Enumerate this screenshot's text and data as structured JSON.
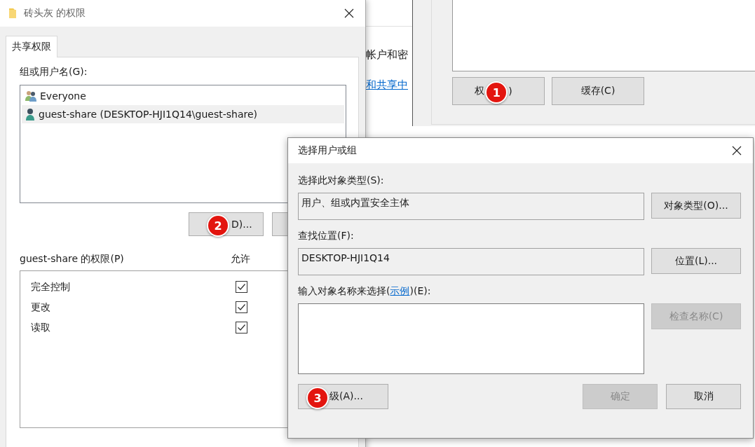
{
  "background_window": {
    "buttons": [
      {
        "label_before": "权",
        "label_after": ")",
        "badge": "1"
      },
      {
        "label": "缓存(C)"
      }
    ]
  },
  "middle_window": {
    "text": "帐户和密",
    "link": "和共享中"
  },
  "permissions_dialog": {
    "title": "砖头灰 的权限",
    "tabs": [
      {
        "label": "共享权限",
        "selected": true
      }
    ],
    "groups_label": "组或用户名(G):",
    "principals": [
      {
        "name": "Everyone",
        "kind": "group",
        "selected": false
      },
      {
        "name": "guest-share (DESKTOP-HJI1Q14\\guest-share)",
        "kind": "user",
        "selected": true
      }
    ],
    "buttons": [
      {
        "label_after": "D)...",
        "badge": "2"
      }
    ],
    "permissions_label": "guest-share 的权限(P)",
    "allow_header": "允许",
    "permissions": [
      {
        "name": "完全控制",
        "allow": true
      },
      {
        "name": "更改",
        "allow": true
      },
      {
        "name": "读取",
        "allow": true
      }
    ]
  },
  "select_dialog": {
    "title": "选择用户或组",
    "object_type_label": "选择此对象类型(S):",
    "object_type": "用户、组或内置安全主体",
    "object_type_button": {
      "label": "对象类型(O)...",
      "disabled": false
    },
    "location_label": "查找位置(F):",
    "location": "DESKTOP-HJI1Q14",
    "location_button": {
      "label": "位置(L)...",
      "disabled": false
    },
    "names_label": {
      "before": "输入对象名称来选择(",
      "link": "示例",
      "after": ")(E):"
    },
    "check_names_button": {
      "label": "检查名称(C)",
      "disabled": true
    },
    "advanced_button": {
      "label_after": "级(A)...",
      "disabled": false,
      "badge": "3"
    },
    "ok_button": {
      "label": "确定",
      "disabled": true
    },
    "cancel_button": {
      "label": "取消",
      "disabled": false
    }
  }
}
